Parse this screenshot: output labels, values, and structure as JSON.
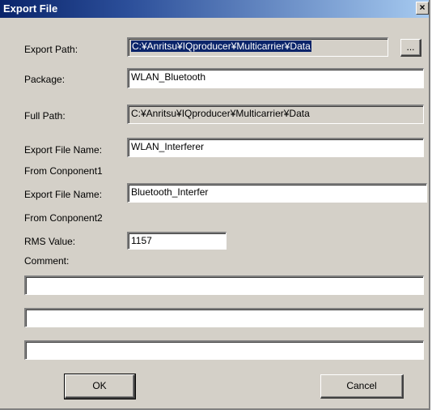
{
  "window": {
    "title": "Export File",
    "close_glyph": "×"
  },
  "labels": {
    "export_path": "Export Path:",
    "package": "Package:",
    "full_path": "Full Path:",
    "export_file_name_1": "Export File Name:",
    "from_component_1": "From Conponent1",
    "export_file_name_2": "Export File Name:",
    "from_component_2": "From Conponent2",
    "rms_value": "RMS Value:",
    "comment": "Comment:"
  },
  "fields": {
    "export_path": "C:¥Anritsu¥IQproducer¥Multicarrier¥Data",
    "package": "WLAN_Bluetooth",
    "full_path": "C:¥Anritsu¥IQproducer¥Multicarrier¥Data",
    "export_file_name_1": "WLAN_Interferer",
    "export_file_name_2": "Bluetooth_Interfer",
    "rms_value": "1157",
    "comment_1": "",
    "comment_2": "",
    "comment_3": ""
  },
  "buttons": {
    "browse": "...",
    "ok": "OK",
    "cancel": "Cancel"
  },
  "colors": {
    "title_bar": "#0a246a",
    "dialog_face": "#d4d0c8",
    "selection": "#0a246a"
  }
}
